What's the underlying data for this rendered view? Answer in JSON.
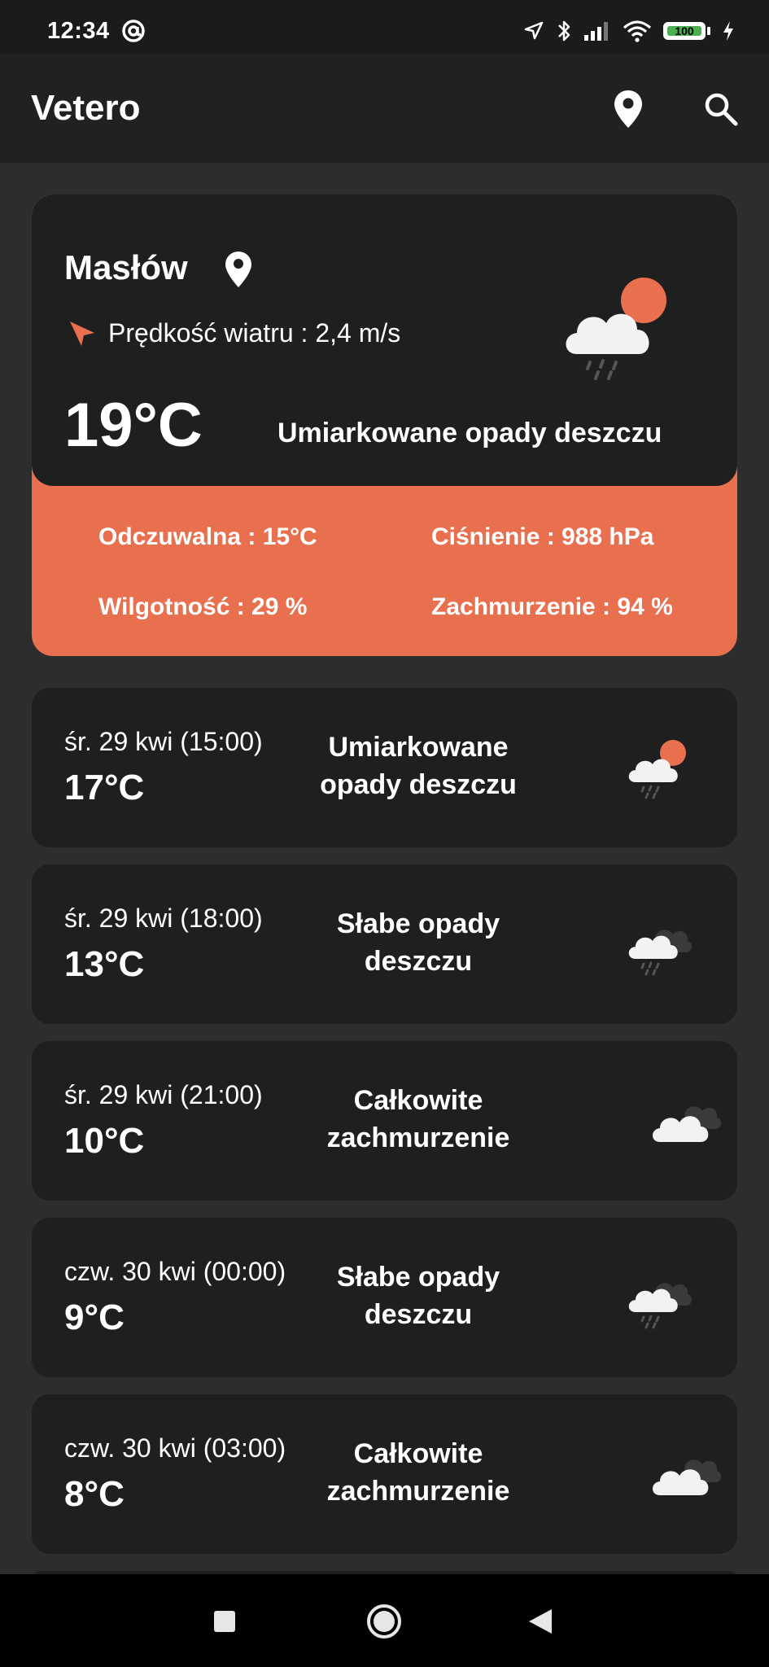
{
  "status_bar": {
    "time": "12:34",
    "battery": "100",
    "icons": [
      "at-sign-icon",
      "location-arrow-icon",
      "bluetooth-icon",
      "signal-icon",
      "wifi-icon",
      "battery-icon",
      "charging-icon"
    ]
  },
  "app_bar": {
    "title": "Vetero",
    "icons": [
      "location-pin-icon",
      "search-icon"
    ]
  },
  "current": {
    "city": "Masłów",
    "wind": "Prędkość wiatru : 2,4 m/s",
    "temperature": "19°C",
    "description": "Umiarkowane opady deszczu",
    "icon": "rain-cloud-sun-icon",
    "feels_like": "Odczuwalna : 15°C",
    "pressure": "Ciśnienie : 988 hPa",
    "humidity": "Wilgotność : 29 %",
    "cloudiness": "Zachmurzenie : 94 %",
    "accent_color": "#e9704f"
  },
  "forecast": [
    {
      "date": "śr. 29 kwi (15:00)",
      "temp": "17°C",
      "desc_line1": "Umiarkowane",
      "desc_line2": "opady deszczu",
      "icon": "rain-cloud-sun-icon"
    },
    {
      "date": "śr. 29 kwi (18:00)",
      "temp": "13°C",
      "desc_line1": "Słabe opady",
      "desc_line2": "deszczu",
      "icon": "rain-cloud-icon"
    },
    {
      "date": "śr. 29 kwi (21:00)",
      "temp": "10°C",
      "desc_line1": "Całkowite",
      "desc_line2": "zachmurzenie",
      "icon": "overcast-cloud-icon"
    },
    {
      "date": "czw. 30 kwi (00:00)",
      "temp": "9°C",
      "desc_line1": "Słabe opady",
      "desc_line2": "deszczu",
      "icon": "rain-cloud-icon"
    },
    {
      "date": "czw. 30 kwi (03:00)",
      "temp": "8°C",
      "desc_line1": "Całkowite",
      "desc_line2": "zachmurzenie",
      "icon": "overcast-cloud-icon"
    }
  ],
  "nav_bar": {
    "icons": [
      "recents-square-icon",
      "home-circle-icon",
      "back-triangle-icon"
    ]
  }
}
